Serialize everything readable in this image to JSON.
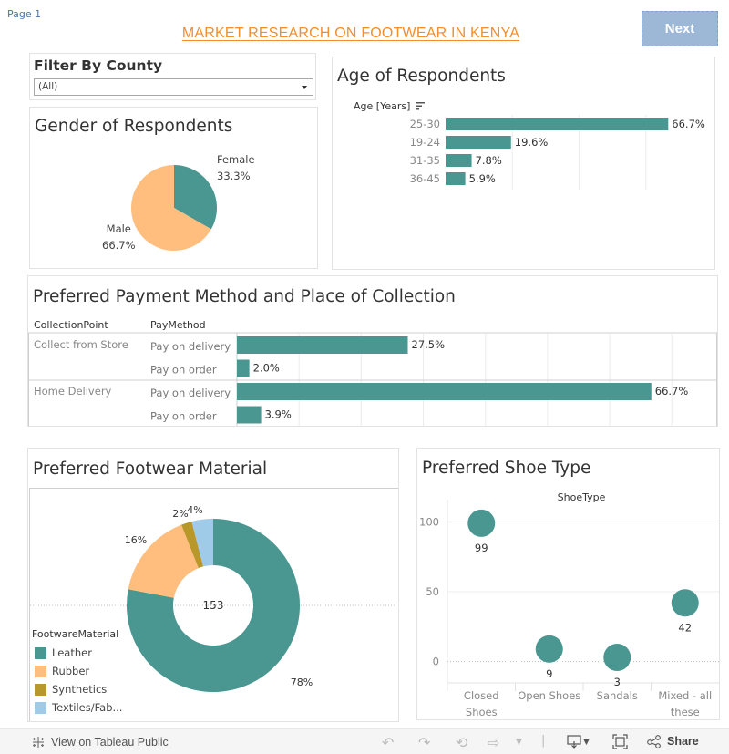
{
  "page": {
    "label": "Page 1",
    "title": "MARKET RESEARCH ON FOOTWEAR IN KENYA",
    "next_label": "Next"
  },
  "colors": {
    "teal": "#4a9791",
    "orange": "#ffbe7d",
    "olive": "#b8982a",
    "lightblue": "#a0cbe8",
    "title_orange": "#f28e2b",
    "next_bg": "#9db8d7"
  },
  "filter": {
    "title": "Filter By County",
    "selected": "(All)"
  },
  "footer": {
    "tableau_link": "View on Tableau Public",
    "share_label": "Share"
  },
  "chart_data": [
    {
      "id": "gender",
      "type": "pie",
      "title": "Gender of Respondents",
      "categories": [
        "Female",
        "Male"
      ],
      "values": [
        33.3,
        66.7
      ],
      "labels": [
        "33.3%",
        "66.7%"
      ],
      "colors": [
        "#4a9791",
        "#ffbe7d"
      ]
    },
    {
      "id": "age",
      "type": "bar",
      "orientation": "horizontal",
      "title": "Age of Respondents",
      "ylabel": "Age [Years]",
      "categories": [
        "25-30",
        "19-24",
        "31-35",
        "36-45"
      ],
      "values": [
        66.7,
        19.6,
        7.8,
        5.9
      ],
      "labels": [
        "66.7%",
        "19.6%",
        "7.8%",
        "5.9%"
      ],
      "xlim": [
        0,
        80
      ],
      "grid": true
    },
    {
      "id": "payment",
      "type": "bar",
      "orientation": "horizontal",
      "title": "Preferred Payment Method and Place of Collection",
      "headers": [
        "CollectionPoint",
        "PayMethod"
      ],
      "rows": [
        {
          "group": "Collect from Store",
          "method": "Pay on delivery",
          "value": 27.5,
          "label": "27.5%"
        },
        {
          "group": "",
          "method": "Pay on order",
          "value": 2.0,
          "label": "2.0%"
        },
        {
          "group": "Home Delivery",
          "method": "Pay on delivery",
          "value": 66.7,
          "label": "66.7%"
        },
        {
          "group": "",
          "method": "Pay on order",
          "value": 3.9,
          "label": "3.9%"
        }
      ],
      "xlim": [
        0,
        77
      ],
      "grid": true
    },
    {
      "id": "material",
      "type": "pie",
      "donut": true,
      "title": "Preferred Footwear Material",
      "center_label": "153",
      "legend_title": "FootwareMaterial",
      "legend_position": "bottom-left",
      "categories": [
        "Leather",
        "Rubber",
        "Synthetics",
        "Textiles/Fab..."
      ],
      "values": [
        78,
        16,
        2,
        4
      ],
      "labels": [
        "78%",
        "16%",
        "2%",
        "4%"
      ],
      "colors": [
        "#4a9791",
        "#ffbe7d",
        "#b8982a",
        "#a0cbe8"
      ]
    },
    {
      "id": "shoetype",
      "type": "scatter",
      "title": "Preferred Shoe Type",
      "xlabel": "ShoeType",
      "categories": [
        "Closed Shoes",
        "Open Shoes",
        "Sandals",
        "Mixed - all these"
      ],
      "category_lines": [
        [
          "Closed",
          "Shoes"
        ],
        [
          "Open Shoes"
        ],
        [
          "Sandals"
        ],
        [
          "Mixed - all",
          "these"
        ]
      ],
      "values": [
        99,
        9,
        3,
        42
      ],
      "labels": [
        "99",
        "9",
        "3",
        "42"
      ],
      "yticks": [
        0,
        50,
        100
      ],
      "ylim": [
        -12,
        112
      ],
      "grid": true
    }
  ]
}
